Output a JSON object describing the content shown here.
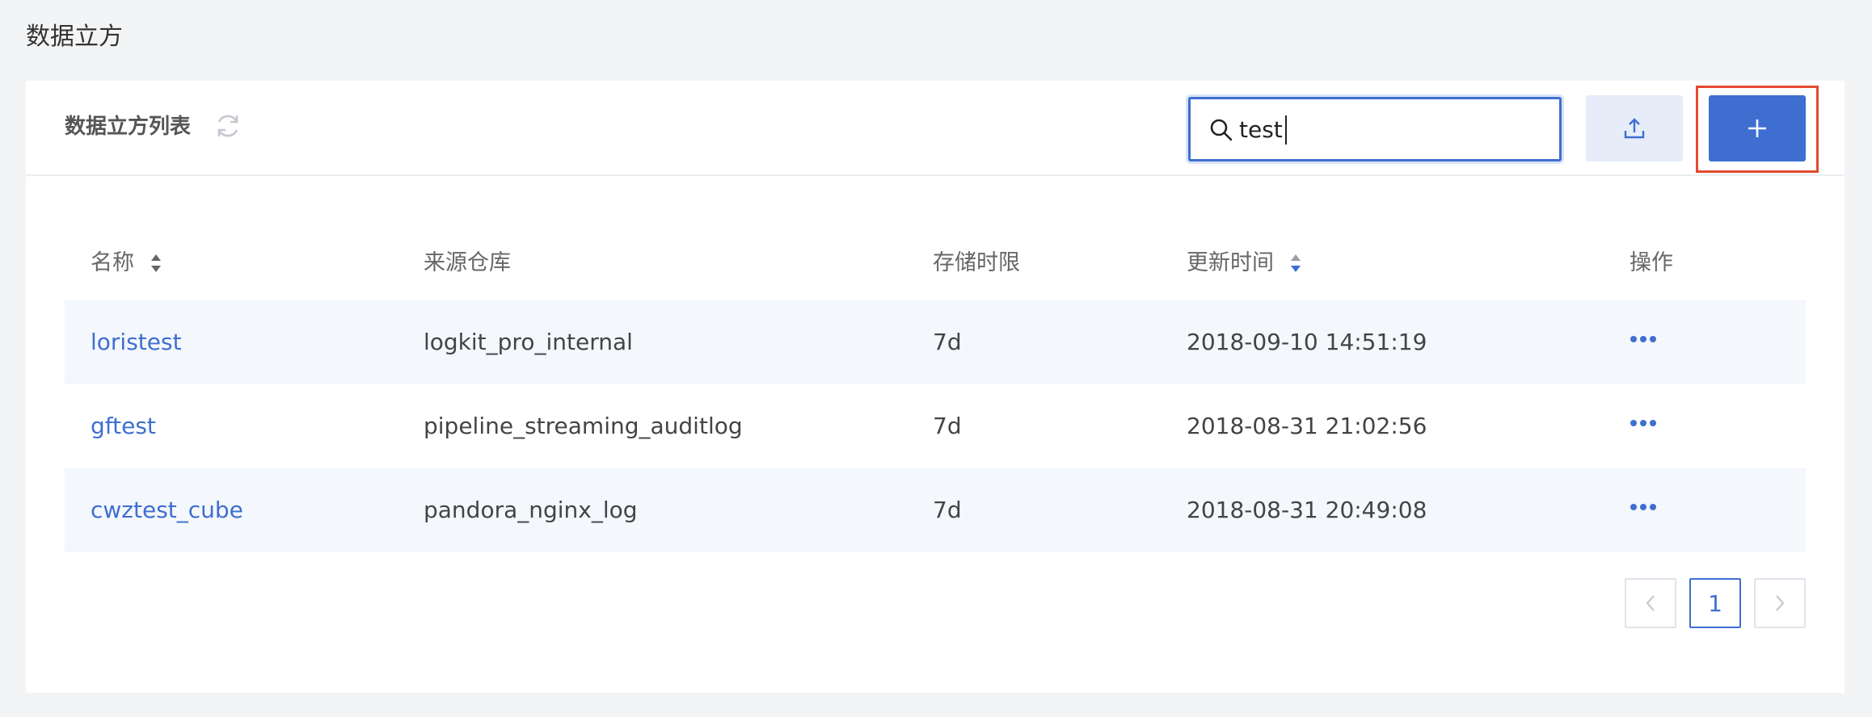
{
  "page": {
    "title": "数据立方"
  },
  "card": {
    "title": "数据立方列表"
  },
  "search": {
    "value": "test"
  },
  "colors": {
    "accent": "#3e6fd0",
    "highlight": "#e34a2f",
    "row_alt": "#f4f7fc"
  },
  "table": {
    "headers": {
      "name": "名称",
      "source": "来源仓库",
      "retention": "存储时限",
      "updated": "更新时间",
      "actions": "操作"
    },
    "rows": [
      {
        "name": "loristest",
        "source": "logkit_pro_internal",
        "retention": "7d",
        "updated": "2018-09-10 14:51:19"
      },
      {
        "name": "gftest",
        "source": "pipeline_streaming_auditlog",
        "retention": "7d",
        "updated": "2018-08-31 21:02:56"
      },
      {
        "name": "cwztest_cube",
        "source": "pandora_nginx_log",
        "retention": "7d",
        "updated": "2018-08-31 20:49:08"
      }
    ]
  },
  "pagination": {
    "current": "1"
  },
  "icons": {
    "refresh": "refresh-icon",
    "search": "search-icon",
    "upload": "upload-icon",
    "add": "plus-icon",
    "sort": "sort-icon",
    "more": "more-icon",
    "prev": "chevron-left-icon",
    "next": "chevron-right-icon"
  }
}
